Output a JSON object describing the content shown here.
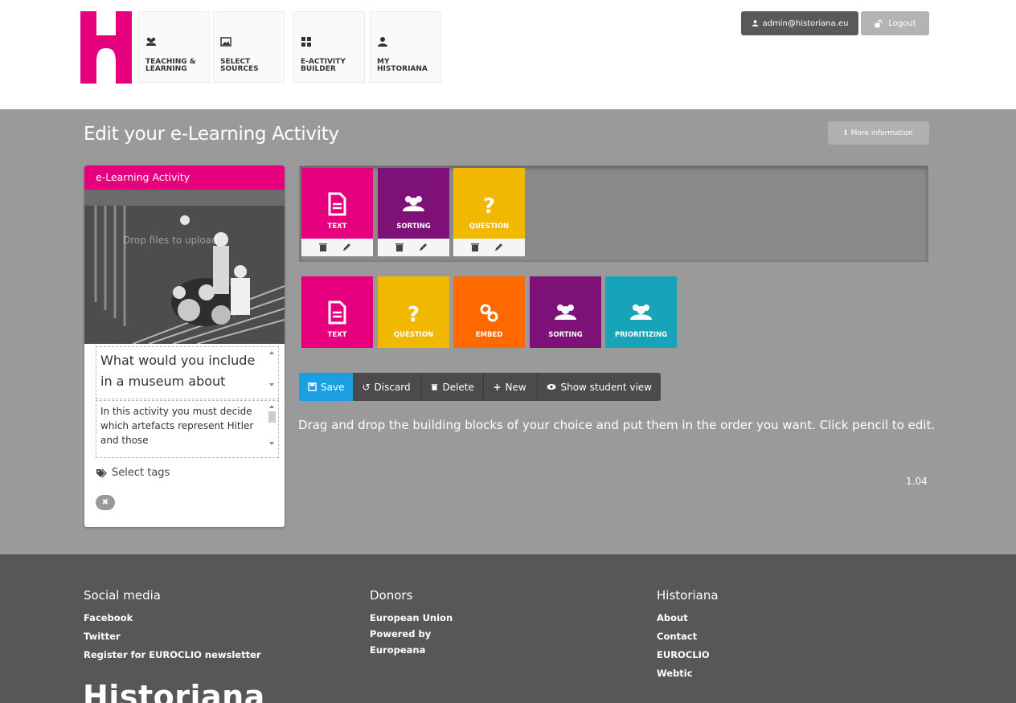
{
  "header": {
    "nav": [
      {
        "label": "TEACHING &\nLEARNING",
        "icon": "users-icon"
      },
      {
        "label": "SELECT\nSOURCES",
        "icon": "image-icon"
      },
      {
        "label": "E-ACTIVITY\nBUILDER",
        "icon": "grid-icon"
      },
      {
        "label": "MY\nHISTORIANA",
        "icon": "user-icon"
      }
    ],
    "user_email": "admin@historiana.eu",
    "logout_label": "Logout"
  },
  "main": {
    "title": "Edit your e-Learning Activity",
    "more_info_label": "More information",
    "card": {
      "header": "e-Learning Activity",
      "drop_text": "Drop files to upload",
      "title_value": "What would you include in a museum about",
      "description_value": "In this activity you must decide which artefacts represent Hitler and those",
      "select_tags_label": "Select tags"
    },
    "selected_blocks": [
      {
        "label": "TEXT",
        "color": "#e6007e",
        "icon": "document-icon"
      },
      {
        "label": "SORTING",
        "color": "#7d1178",
        "icon": "group-icon"
      },
      {
        "label": "QUESTION",
        "color": "#f0b800",
        "icon": "question-icon"
      }
    ],
    "palette_blocks": [
      {
        "label": "TEXT",
        "color": "#e6007e",
        "icon": "document-icon"
      },
      {
        "label": "QUESTION",
        "color": "#f0b800",
        "icon": "question-icon"
      },
      {
        "label": "EMBED",
        "color": "#ff6a00",
        "icon": "link-icon"
      },
      {
        "label": "SORTING",
        "color": "#7d1178",
        "icon": "group-icon"
      },
      {
        "label": "PRIORITIZING",
        "color": "#17a3b8",
        "icon": "group-icon"
      }
    ],
    "toolbar": {
      "save": "Save",
      "discard": "Discard",
      "delete": "Delete",
      "new": "New",
      "student_view": "Show student view"
    },
    "instructions": "Drag and drop the building blocks of your choice and put them in the order you want. Click pencil to edit.",
    "version": "1.04"
  },
  "footer": {
    "social": {
      "heading": "Social media",
      "links": [
        "Facebook",
        "Twitter",
        "Register for EUROCLIO newsletter"
      ]
    },
    "donors": {
      "heading": "Donors",
      "links": [
        "European Union",
        "Powered by",
        "Europeana"
      ]
    },
    "historiana": {
      "heading": "Historiana",
      "links": [
        "About",
        "Contact",
        "EUROCLIO",
        "Webtic"
      ]
    },
    "brand": "Historiana"
  }
}
